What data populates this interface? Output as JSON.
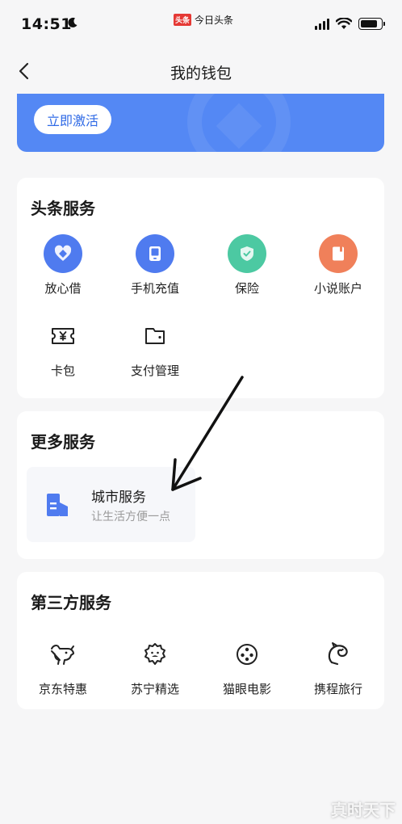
{
  "status_bar": {
    "time": "14:51",
    "carrier_logo": "头条",
    "carrier_text": "今日头条",
    "battery_level": 0.85
  },
  "nav": {
    "title": "我的钱包",
    "back_icon": "chevron-left-icon"
  },
  "banner": {
    "button_label": "立即激活",
    "color": "#5488f4"
  },
  "toutiao_services": {
    "title": "头条服务",
    "items": [
      {
        "label": "放心借",
        "icon": "heart-diamond-icon",
        "color": "#4f7bef"
      },
      {
        "label": "手机充值",
        "icon": "phone-icon",
        "color": "#4f7bef"
      },
      {
        "label": "保险",
        "icon": "shield-check-icon",
        "color": "#4cc9a2"
      },
      {
        "label": "小说账户",
        "icon": "book-icon",
        "color": "#f0805a"
      },
      {
        "label": "卡包",
        "icon": "ticket-yen-icon",
        "color": "#222222"
      },
      {
        "label": "支付管理",
        "icon": "wallet-icon",
        "color": "#222222"
      }
    ]
  },
  "more_services": {
    "title": "更多服务",
    "city": {
      "name": "城市服务",
      "subtitle": "让生活方便一点",
      "icon": "city-building-icon"
    }
  },
  "third_party": {
    "title": "第三方服务",
    "items": [
      {
        "label": "京东特惠",
        "icon": "jd-dog-icon"
      },
      {
        "label": "苏宁精选",
        "icon": "suning-lion-icon"
      },
      {
        "label": "猫眼电影",
        "icon": "film-reel-icon"
      },
      {
        "label": "携程旅行",
        "icon": "ctrip-dolphin-icon"
      }
    ]
  },
  "watermark": "真时天下"
}
